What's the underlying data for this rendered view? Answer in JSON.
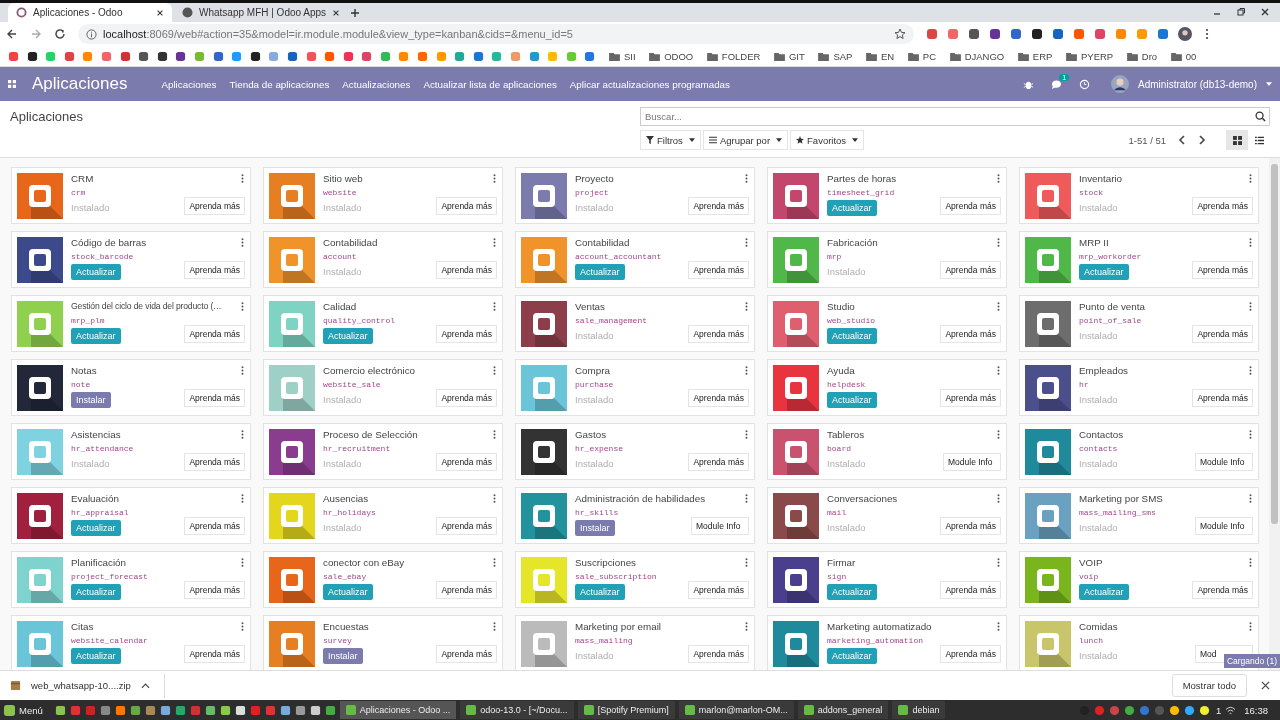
{
  "browser": {
    "tabs": [
      {
        "title": "Aplicaciones - Odoo",
        "selected": true
      },
      {
        "title": "Whatsapp MFH | Odoo Apps",
        "selected": false
      }
    ],
    "url_host": "localhost",
    "url_rest": ":8069/web#action=35&model=ir.module.module&view_type=kanban&cids=&menu_id=5",
    "bookmark_folders": [
      "SII",
      "ODOO",
      "FOLDER",
      "GIT",
      "SAP",
      "EN",
      "PC",
      "DJANGO",
      "ERP",
      "PYERP",
      "Dro",
      "00"
    ]
  },
  "navbar": {
    "brand": "Aplicaciones",
    "menu": [
      "Aplicaciones",
      "Tienda de aplicaciones",
      "Actualizaciones",
      "Actualizar lista de aplicaciones",
      "Aplicar actualizaciones programadas"
    ],
    "chat_count": "1",
    "user": "Administrator (db13-demo)"
  },
  "control_panel": {
    "breadcrumb": "Aplicaciones",
    "search": {
      "placeholder": "Buscar..."
    },
    "filters": [
      {
        "label": "Filtros",
        "kind": "filter"
      },
      {
        "label": "Agrupar por",
        "kind": "group"
      },
      {
        "label": "Favoritos",
        "kind": "favorite"
      }
    ],
    "pager": "1-51 / 51",
    "views": [
      {
        "kind": "kanban",
        "selected": true
      },
      {
        "kind": "list",
        "selected": false
      }
    ]
  },
  "apps": [
    {
      "name": "CRM",
      "technical": "crm",
      "kind": "installed",
      "status_text": "Instalado",
      "info_button": "Aprenda más",
      "color": "#e8661a"
    },
    {
      "name": "Sitio web",
      "technical": "website",
      "kind": "installed",
      "status_text": "Instalado",
      "info_button": "Aprenda más",
      "color": "#e67e22"
    },
    {
      "name": "Proyecto",
      "technical": "project",
      "kind": "installed",
      "status_text": "Instalado",
      "info_button": "Aprenda más",
      "color": "#7c7bad"
    },
    {
      "name": "Partes de horas",
      "technical": "timesheet_grid",
      "kind": "update",
      "status_text": "Actualizar",
      "info_button": "Aprenda más",
      "color": "#c3466c"
    },
    {
      "name": "Inventario",
      "technical": "stock",
      "kind": "installed",
      "status_text": "Instalado",
      "info_button": "Aprenda más",
      "color": "#ef5b5b"
    },
    {
      "name": "Código de barras",
      "technical": "stock_barcode",
      "kind": "update",
      "status_text": "Actualizar",
      "info_button": "Aprenda más",
      "color": "#3c4a8c"
    },
    {
      "name": "Contabilidad",
      "technical": "account",
      "kind": "installed",
      "status_text": "Instalado",
      "info_button": "Aprenda más",
      "color": "#f0932b"
    },
    {
      "name": "Contabilidad",
      "technical": "account_accountant",
      "kind": "update",
      "status_text": "Actualizar",
      "info_button": "Aprenda más",
      "color": "#f0932b"
    },
    {
      "name": "Fabricación",
      "technical": "mrp",
      "kind": "installed",
      "status_text": "Instalado",
      "info_button": "Aprenda más",
      "color": "#50b848"
    },
    {
      "name": "MRP II",
      "technical": "mrp_workorder",
      "kind": "update",
      "status_text": "Actualizar",
      "info_button": "Aprenda más",
      "color": "#50b848"
    },
    {
      "name": "Gestión del ciclo de vida del producto (…",
      "technical": "mrp_plm",
      "kind": "update",
      "status_text": "Actualizar",
      "info_button": "Aprenda más",
      "color": "#8fd14f"
    },
    {
      "name": "Calidad",
      "technical": "quality_control",
      "kind": "update",
      "status_text": "Actualizar",
      "info_button": "Aprenda más",
      "color": "#7fd3c3"
    },
    {
      "name": "Ventas",
      "technical": "sale_management",
      "kind": "installed",
      "status_text": "Instalado",
      "info_button": "Aprenda más",
      "color": "#8c3f4a"
    },
    {
      "name": "Studio",
      "technical": "web_studio",
      "kind": "update",
      "status_text": "Actualizar",
      "info_button": "Aprenda más",
      "color": "#e05f6e"
    },
    {
      "name": "Punto de venta",
      "technical": "point_of_sale",
      "kind": "installed",
      "status_text": "Instalado",
      "info_button": "Aprenda más",
      "color": "#6d6d6d"
    },
    {
      "name": "Notas",
      "technical": "note",
      "kind": "install",
      "status_text": "Instalar",
      "info_button": "Aprenda más",
      "color": "#22273a"
    },
    {
      "name": "Comercio electrónico",
      "technical": "website_sale",
      "kind": "installed",
      "status_text": "Instalado",
      "info_button": "Aprenda más",
      "color": "#9fd0c7"
    },
    {
      "name": "Compra",
      "technical": "purchase",
      "kind": "installed",
      "status_text": "Instalado",
      "info_button": "Aprenda más",
      "color": "#6ac5d9"
    },
    {
      "name": "Ayuda",
      "technical": "helpdesk",
      "kind": "update",
      "status_text": "Actualizar",
      "info_button": "Aprenda más",
      "color": "#e7343f"
    },
    {
      "name": "Empleados",
      "technical": "hr",
      "kind": "installed",
      "status_text": "Instalado",
      "info_button": "Aprenda más",
      "color": "#4b4f8c"
    },
    {
      "name": "Asistencias",
      "technical": "hr_attendance",
      "kind": "installed",
      "status_text": "Instalado",
      "info_button": "Aprenda más",
      "color": "#7fd3e0"
    },
    {
      "name": "Proceso de Selección",
      "technical": "hr_recruitment",
      "kind": "installed",
      "status_text": "Instalado",
      "info_button": "Aprenda más",
      "color": "#8a3c8f"
    },
    {
      "name": "Gastos",
      "technical": "hr_expense",
      "kind": "installed",
      "status_text": "Instalado",
      "info_button": "Aprenda más",
      "color": "#333333"
    },
    {
      "name": "Tableros",
      "technical": "board",
      "kind": "installed",
      "status_text": "Instalado",
      "info_button": "Module Info",
      "color": "#c9536e"
    },
    {
      "name": "Contactos",
      "technical": "contacts",
      "kind": "installed",
      "status_text": "Instalado",
      "info_button": "Module Info",
      "color": "#1e8a9c"
    },
    {
      "name": "Evaluación",
      "technical": "hr_appraisal",
      "kind": "update",
      "status_text": "Actualizar",
      "info_button": "Aprenda más",
      "color": "#a0203d"
    },
    {
      "name": "Ausencias",
      "technical": "hr_holidays",
      "kind": "installed",
      "status_text": "Instalado",
      "info_button": "Aprenda más",
      "color": "#e3d61c"
    },
    {
      "name": "Administración de habilidades",
      "technical": "hr_skills",
      "kind": "install",
      "status_text": "Instalar",
      "info_button": "Module Info",
      "color": "#22939c"
    },
    {
      "name": "Conversaciones",
      "technical": "mail",
      "kind": "installed",
      "status_text": "Instalado",
      "info_button": "Aprenda más",
      "color": "#8a4a4a"
    },
    {
      "name": "Marketing por SMS",
      "technical": "mass_mailing_sms",
      "kind": "installed",
      "status_text": "Instalado",
      "info_button": "Module Info",
      "color": "#6aa0c0"
    },
    {
      "name": "Planificación",
      "technical": "project_forecast",
      "kind": "update",
      "status_text": "Actualizar",
      "info_button": "Aprenda más",
      "color": "#7fd3cf"
    },
    {
      "name": "conector con eBay",
      "technical": "sale_ebay",
      "kind": "update",
      "status_text": "Actualizar",
      "info_button": "Aprenda más",
      "color": "#e8661a"
    },
    {
      "name": "Suscripciones",
      "technical": "sale_subscription",
      "kind": "update",
      "status_text": "Actualizar",
      "info_button": "Aprenda más",
      "color": "#e5e52a"
    },
    {
      "name": "Firmar",
      "technical": "sign",
      "kind": "update",
      "status_text": "Actualizar",
      "info_button": "Aprenda más",
      "color": "#4a3f8c"
    },
    {
      "name": "VOIP",
      "technical": "voip",
      "kind": "update",
      "status_text": "Actualizar",
      "info_button": "Aprenda más",
      "color": "#7ab51d"
    },
    {
      "name": "Citas",
      "technical": "website_calendar",
      "kind": "update",
      "status_text": "Actualizar",
      "info_button": "Aprenda más",
      "color": "#6ac5d9"
    },
    {
      "name": "Encuestas",
      "technical": "survey",
      "kind": "install",
      "status_text": "Instalar",
      "info_button": "Aprenda más",
      "color": "#e67e22"
    },
    {
      "name": "Marketing por email",
      "technical": "mass_mailing",
      "kind": "installed",
      "status_text": "Instalado",
      "info_button": "Aprenda más",
      "color": "#bbbbbb"
    },
    {
      "name": "Marketing automatizado",
      "technical": "marketing_automation",
      "kind": "update",
      "status_text": "Actualizar",
      "info_button": "Aprenda más",
      "color": "#1e8a9c"
    },
    {
      "name": "Comidas",
      "technical": "lunch",
      "kind": "installed",
      "status_text": "Instalado",
      "info_button": "Mod",
      "color": "#c8c56a"
    }
  ],
  "loading_badge": "Cargando (1)",
  "download_bar": {
    "file": "web_whatsapp-10....zip",
    "show_all": "Mostrar todo"
  },
  "taskbar": {
    "menu": "Menú",
    "windows": [
      {
        "title": "Aplicaciones - Odoo ...",
        "selected": true
      },
      {
        "title": "odoo-13.0 - [~/Docu...",
        "selected": false
      },
      {
        "title": "[Spotify Premium]",
        "selected": false
      },
      {
        "title": "marlon@marlon-OM...",
        "selected": false
      },
      {
        "title": "addons_general",
        "selected": false
      },
      {
        "title": "debian",
        "selected": false
      }
    ],
    "tray_count": "1",
    "clock": "16:38"
  }
}
